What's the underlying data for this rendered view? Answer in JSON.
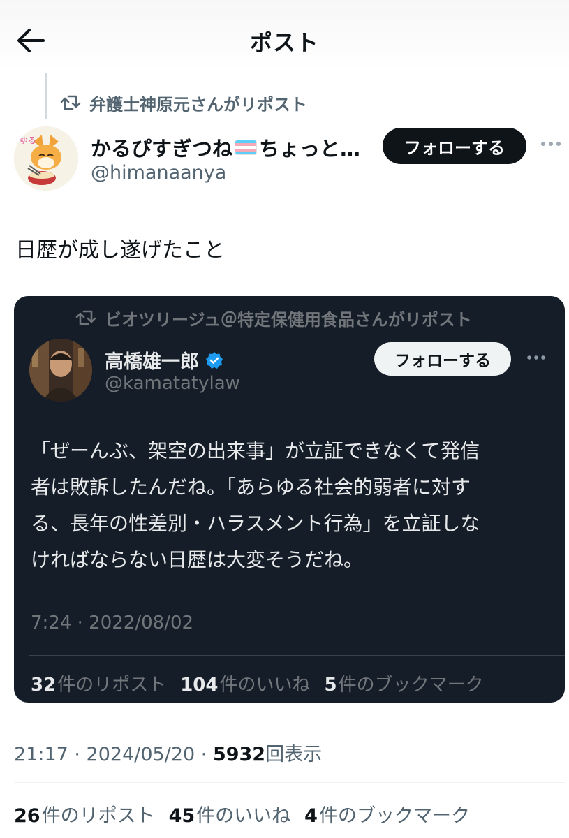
{
  "header": {
    "title": "ポスト"
  },
  "repost_context": {
    "text": "弁護士神原元さんがリポスト"
  },
  "author": {
    "name_prefix": "かるぴすぎつね",
    "name_suffix": "ちょっと…",
    "handle": "@himanaanya",
    "follow_label": "フォローする"
  },
  "tweet": {
    "text": "日歴が成し遂げたこと"
  },
  "quote": {
    "repost_context": "ビオツリージュ＠特定保健用食品さんがリポスト",
    "name": "高橋雄一郎",
    "handle": "@kamatatylaw",
    "follow_label": "フォローする",
    "text_lines": [
      "「ぜーんぶ、架空の出来事」が立証できなくて発信",
      "者は敗訴したんだね。「あらゆる社会的弱者に対す",
      "る、長年の性差別・ハラスメント行為」を立証しな",
      "ければならない日歴は大変そうだね。"
    ],
    "timestamp": "7:24 · 2022/08/02",
    "stats": {
      "reposts_count": "32",
      "reposts_label": "件のリポスト",
      "likes_count": "104",
      "likes_label": "件のいいね",
      "bookmarks_count": "5",
      "bookmarks_label": "件のブックマーク"
    }
  },
  "meta": {
    "time": "21:17 · 2024/05/20 · ",
    "views_count": "5932",
    "views_label": "回表示"
  },
  "stats": {
    "reposts_count": "26",
    "reposts_label": "件のリポスト",
    "likes_count": "45",
    "likes_label": "件のいいね",
    "bookmarks_count": "4",
    "bookmarks_label": "件のブックマーク"
  },
  "colors": {
    "quote_background": "#151d28",
    "verified_blue": "#1d9bf0",
    "follow_button_dark": "#0f1419"
  }
}
